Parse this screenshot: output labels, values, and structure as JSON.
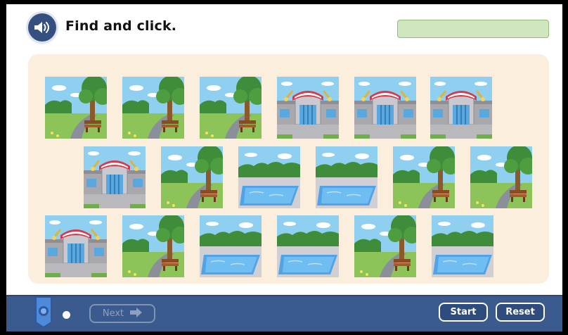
{
  "header": {
    "audio_icon": "speaker-icon",
    "instruction": "Find and click."
  },
  "colors": {
    "frame_blue": "#3b5a8d",
    "board_bg": "#fbeedc",
    "answer_box": "#cfe6bf"
  },
  "cards": [
    [
      "park",
      "park",
      "park",
      "school",
      "school",
      "school"
    ],
    [
      "school",
      "park",
      "pool",
      "pool",
      "park",
      "park"
    ],
    [
      "school",
      "park",
      "pool",
      "pool",
      "park",
      "pool"
    ]
  ],
  "footer": {
    "next_label": "Next",
    "start_label": "Start",
    "reset_label": "Reset"
  }
}
